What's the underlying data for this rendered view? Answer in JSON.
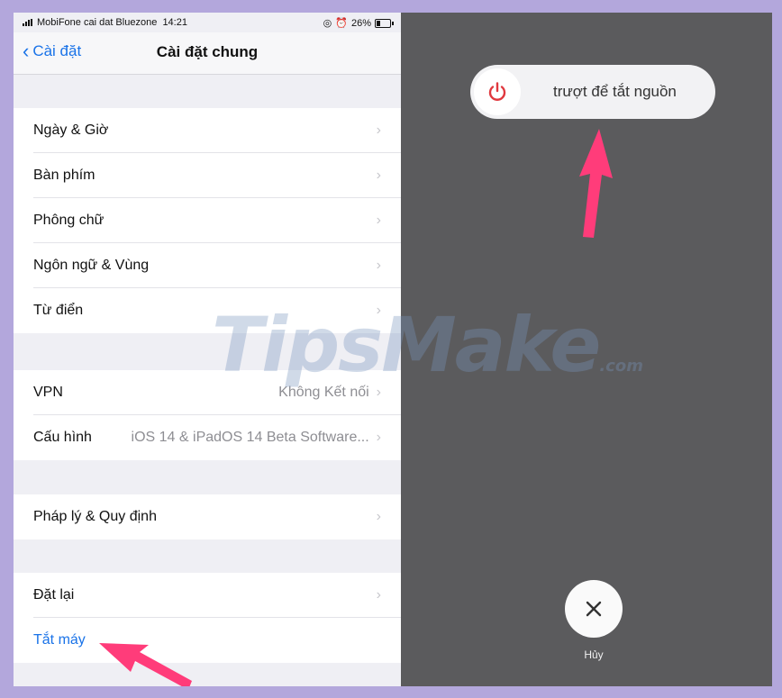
{
  "status_bar": {
    "carrier": "MobiFone cai dat Bluezone",
    "time": "14:21",
    "battery": "26%"
  },
  "nav": {
    "back_label": "Cài đặt",
    "title": "Cài đặt chung"
  },
  "groups": [
    {
      "rows": [
        {
          "label": "Ngày & Giờ"
        },
        {
          "label": "Bàn phím"
        },
        {
          "label": "Phông chữ"
        },
        {
          "label": "Ngôn ngữ & Vùng"
        },
        {
          "label": "Từ điển"
        }
      ]
    },
    {
      "rows": [
        {
          "label": "VPN",
          "detail": "Không Kết nối"
        },
        {
          "label": "Cấu hình",
          "detail": "iOS 14 & iPadOS 14 Beta Software..."
        }
      ]
    },
    {
      "rows": [
        {
          "label": "Pháp lý & Quy định"
        }
      ]
    },
    {
      "rows": [
        {
          "label": "Đặt lại"
        },
        {
          "label": "Tắt máy"
        }
      ]
    }
  ],
  "power": {
    "slide_text": "trượt để tắt nguồn",
    "cancel_label": "Hủy"
  },
  "watermark": {
    "main": "TipsMake",
    "suffix": ".com"
  },
  "colors": {
    "accent": "#1a73e8",
    "power_icon": "#e0383e",
    "arrow": "#ff3c7a",
    "overlay": "#5b5b5d"
  }
}
